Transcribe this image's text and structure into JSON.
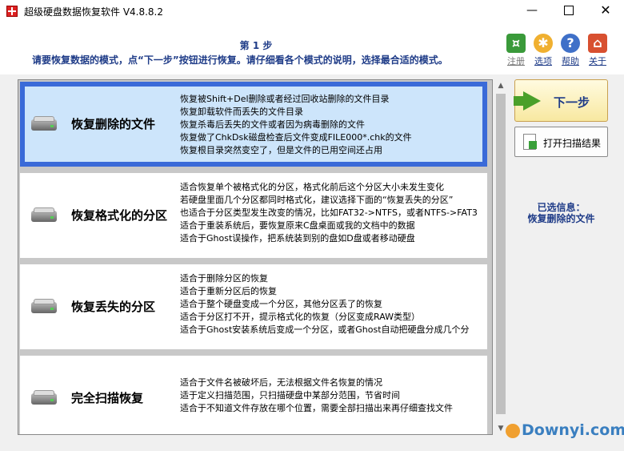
{
  "window": {
    "title": "超级硬盘数据恢复软件 V4.8.8.2",
    "minimize": "—",
    "close": "✕"
  },
  "header": {
    "step_title": "第 1 步",
    "step_desc": "请要恢复数据的模式，点“下一步”按钮进行恢复。请仔细看各个模式的说明，选择最合适的模式。",
    "toolbar": [
      {
        "label": "注册",
        "icon": "cart-icon"
      },
      {
        "label": "选项",
        "icon": "gear-icon"
      },
      {
        "label": "帮助",
        "icon": "help-icon"
      },
      {
        "label": "关于",
        "icon": "home-icon"
      }
    ]
  },
  "modes": [
    {
      "name": "恢复删除的文件",
      "selected": true,
      "lines": [
        "恢复被Shift+Del删除或者经过回收站删除的文件目录",
        "恢复卸载软件而丢失的文件目录",
        "恢复杀毒后丢失的文件或者因为病毒删除的文件",
        "恢复做了ChkDsk磁盘检查后文件变成FILE000*.chk的文件",
        "恢复根目录突然变空了，但是文件的已用空间还占用"
      ]
    },
    {
      "name": "恢复格式化的分区",
      "selected": false,
      "lines": [
        "适合恢复单个被格式化的分区，格式化前后这个分区大小未发生变化",
        "若硬盘里面几个分区都同时格式化，建议选择下面的“恢复丢失的分区”",
        "也适合于分区类型发生改变的情况，比如FAT32->NTFS，或者NTFS->FAT3",
        "适合于重装系统后，要恢复原来C盘桌面或我的文档中的数据",
        "适合于Ghost误操作，把系统装到别的盘如D盘或者移动硬盘"
      ]
    },
    {
      "name": "恢复丢失的分区",
      "selected": false,
      "lines": [
        "适合于删除分区的恢复",
        "适合于重新分区后的恢复",
        "适合于整个硬盘变成一个分区，其他分区丢了的恢复",
        "适合于分区打不开，提示格式化的恢复（分区变成RAW类型）",
        "适合于Ghost安装系统后变成一个分区，或者Ghost自动把硬盘分成几个分"
      ]
    },
    {
      "name": "完全扫描恢复",
      "selected": false,
      "lines": [
        "适合于文件名被破坏后，无法根据文件名恢复的情况",
        "适于定义扫描范围，只扫描硬盘中某部分范围，节省时间",
        "适合于不知道文件存放在哪个位置，需要全部扫描出来再仔细查找文件"
      ]
    }
  ],
  "side": {
    "next_label": "下一步",
    "open_scan_label": "打开扫描结果",
    "selected_title": "已选信息：",
    "selected_value": "恢复删除的文件"
  },
  "watermark": "Downyi.com",
  "colors": {
    "accent_text": "#1f3c88",
    "selection_border": "#3a6ad8",
    "selection_fill": "#cde5fb"
  }
}
